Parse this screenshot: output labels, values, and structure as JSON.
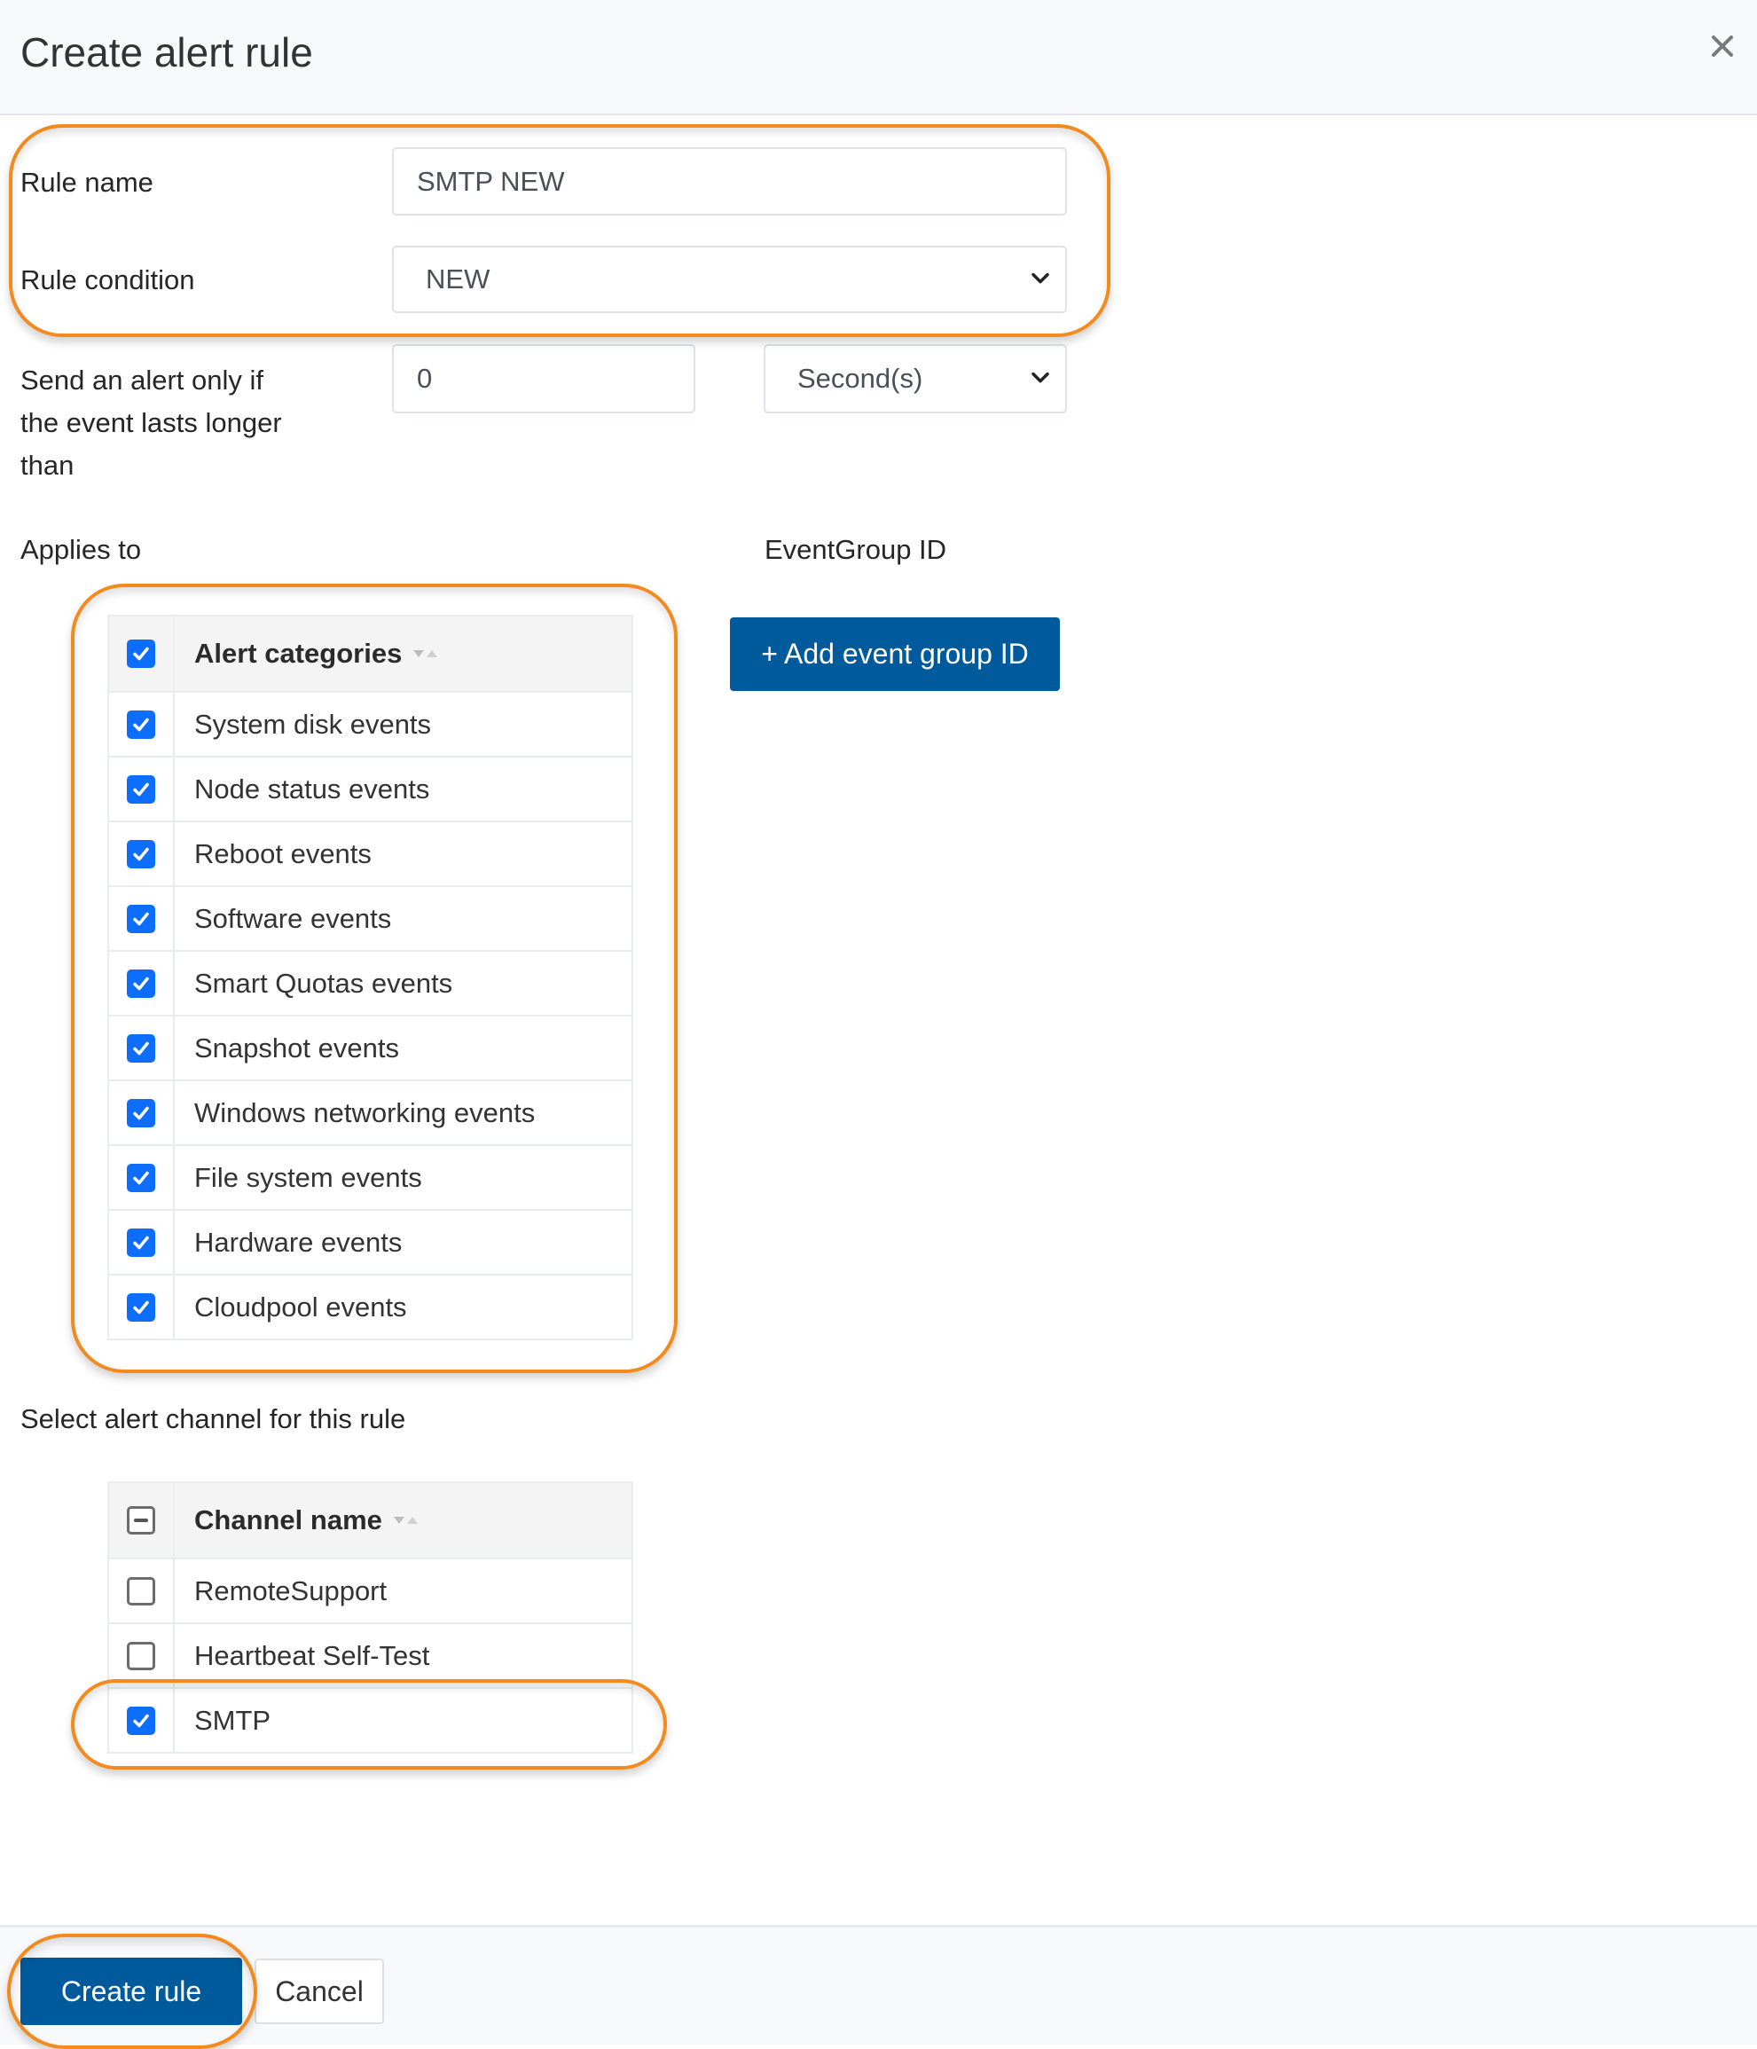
{
  "dialog": {
    "title": "Create alert rule",
    "close_icon": "close-icon"
  },
  "form": {
    "rule_name": {
      "label": "Rule name",
      "value": "SMTP NEW"
    },
    "rule_condition": {
      "label": "Rule condition",
      "selected": "NEW"
    },
    "duration": {
      "label": "Send an alert only if the event lasts longer than",
      "label_lines": [
        "Send an alert only if",
        "the event lasts longer",
        "than"
      ],
      "value": "0",
      "unit_selected": "Second(s)"
    }
  },
  "applies_to": {
    "label": "Applies to",
    "header": {
      "label": "Alert categories",
      "checked": true
    },
    "categories": [
      {
        "label": "System disk events",
        "checked": true
      },
      {
        "label": "Node status events",
        "checked": true
      },
      {
        "label": "Reboot events",
        "checked": true
      },
      {
        "label": "Software events",
        "checked": true
      },
      {
        "label": "Smart Quotas events",
        "checked": true
      },
      {
        "label": "Snapshot events",
        "checked": true
      },
      {
        "label": "Windows networking events",
        "checked": true
      },
      {
        "label": "File system events",
        "checked": true
      },
      {
        "label": "Hardware events",
        "checked": true
      },
      {
        "label": "Cloudpool events",
        "checked": true
      }
    ]
  },
  "event_group": {
    "label": "EventGroup ID",
    "add_button": "+ Add event group ID"
  },
  "channels": {
    "label": "Select alert channel for this rule",
    "header": {
      "label": "Channel name",
      "state": "indeterminate"
    },
    "items": [
      {
        "label": "RemoteSupport",
        "checked": false
      },
      {
        "label": "Heartbeat Self-Test",
        "checked": false
      },
      {
        "label": "SMTP",
        "checked": true
      }
    ]
  },
  "footer": {
    "create_button": "Create rule",
    "cancel_button": "Cancel"
  },
  "colors": {
    "primary": "#005a9c",
    "checkbox": "#0d6efd",
    "highlight": "#f28a1e"
  }
}
